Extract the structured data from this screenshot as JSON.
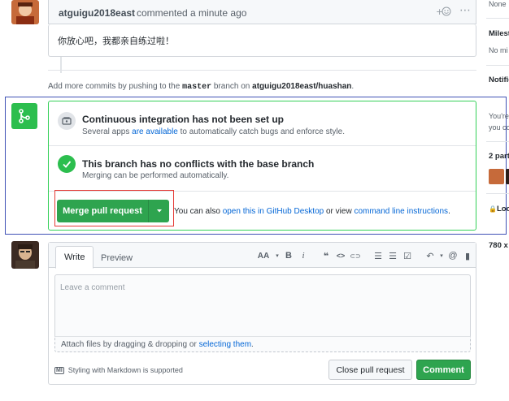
{
  "top_comment": {
    "author": "atguigu2018east",
    "action": "commented a minute ago",
    "body": "你放心吧，我都亲自练过啦！",
    "reaction_icon": "smiley-icon",
    "menu_icon": "kebab-horizontal-icon"
  },
  "push_note": {
    "prefix": "Add more commits by pushing to the",
    "branch": "master",
    "middle": "branch on",
    "repo": "atguigu2018east/huashan",
    "suffix": "."
  },
  "merge": {
    "ci_title": "Continuous integration has not been set up",
    "ci_desc_prefix": "Several apps",
    "ci_desc_link": "are available",
    "ci_desc_suffix": "to automatically catch bugs and enforce style.",
    "conflict_title": "This branch has no conflicts with the base branch",
    "conflict_desc": "Merging can be performed automatically.",
    "merge_button": "Merge pull request",
    "alt_prefix": "You can also",
    "alt_link1": "open this in GitHub Desktop",
    "alt_middle": "or view",
    "alt_link2": "command line instructions",
    "alt_suffix": "."
  },
  "editor": {
    "tab_write": "Write",
    "tab_preview": "Preview",
    "placeholder": "Leave a comment",
    "attach_prefix": "Attach files by dragging & dropping or",
    "attach_link": "selecting them",
    "attach_suffix": ".",
    "markdown_badge": "MI",
    "markdown_note": "Styling with Markdown is supported",
    "close_button": "Close pull request",
    "comment_button": "Comment",
    "toolbar": {
      "heading": "AA",
      "bold": "B",
      "italic": "i",
      "quote": "❝",
      "code": "<>",
      "link": "⊂⊃",
      "ul": "☰",
      "ol": "☰",
      "tasks": "☑",
      "reply": "↶",
      "mention": "@",
      "bookmark": "▮"
    }
  },
  "sidebar": {
    "none": "None",
    "milestone_head": "Milest",
    "milestone_val": "No mi",
    "notif_head": "Notific",
    "notif_line1": "You're",
    "notif_line2": "you co",
    "participants_head": "2 part",
    "lock_label": "Loc",
    "size_text": "780 x"
  },
  "colors": {
    "green": "#2ea44f",
    "link_blue": "#0366d6",
    "merge_border": "#34d058",
    "highlight_blue": "#3f51b5",
    "highlight_red": "#e53935"
  }
}
